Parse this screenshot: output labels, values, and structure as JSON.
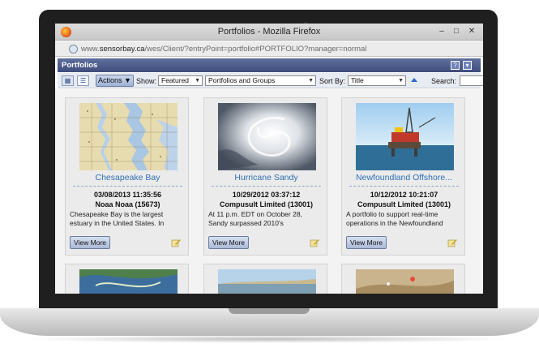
{
  "browser": {
    "window_title": "Portfolios - Mozilla Firefox",
    "url_prefix": "www.",
    "url_domain": "sensorbay.ca",
    "url_path": "/wes/Client/?entryPoint=portfolio#PORTFOLIO?manager=normal",
    "minimize": "–",
    "maximize": "□",
    "close": "✕"
  },
  "panel": {
    "title": "Portfolios",
    "help_icon": "?"
  },
  "toolbar": {
    "actions_label": "Actions ▼",
    "show_label": "Show:",
    "show_value": "Featured",
    "filter_value": "Portfolios and Groups",
    "sort_label": "Sort By:",
    "sort_value": "Title",
    "search_label": "Search:",
    "search_value": ""
  },
  "cards": [
    {
      "title": "Chesapeake Bay",
      "date": "03/08/2013 11:35:56",
      "owner": "Noaa Noaa (15673)",
      "description": "Chesapeake Bay is the largest estuary in the United States. In",
      "button": "View More"
    },
    {
      "title": "Hurricane Sandy",
      "date": "10/29/2012 03:37:12",
      "owner": "Compusult Limited (13001)",
      "description": "At 11 p.m. EDT on October 28, Sandy surpassed 2010's",
      "button": "View More"
    },
    {
      "title": "Newfoundland Offshore...",
      "date": "10/12/2012 10:21:07",
      "owner": "Compusult Limited (13001)",
      "description": "A portfolio to support real-time operations in the Newfoundland",
      "button": "View More"
    }
  ],
  "colors": {
    "panel_header": "#4a5888",
    "link_title": "#2f6fb5",
    "laptop_bezel": "#1f1f1f"
  }
}
